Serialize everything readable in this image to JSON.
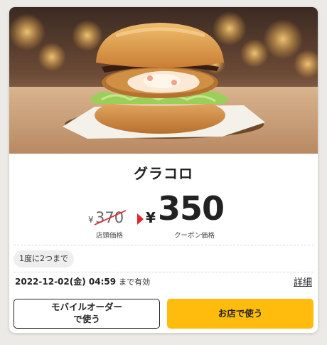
{
  "coupon": {
    "product_name": "グラコロ",
    "old_price": {
      "currency": "¥",
      "value": "370",
      "label": "店頭価格"
    },
    "new_price": {
      "currency": "¥",
      "value": "350",
      "label": "クーポン価格"
    },
    "usage_limit": "1度に2つまで",
    "expiry": {
      "datetime": "2022-12-02(金) 04:59",
      "suffix": "まで有効"
    },
    "details_link": "詳細",
    "buttons": {
      "mobile_order": "モバイルオーダー\nで使う",
      "use_in_store": "お店で使う"
    }
  },
  "colors": {
    "accent_yellow": "#ffbc0d",
    "arrow_red": "#e0262f",
    "text": "#222222"
  }
}
